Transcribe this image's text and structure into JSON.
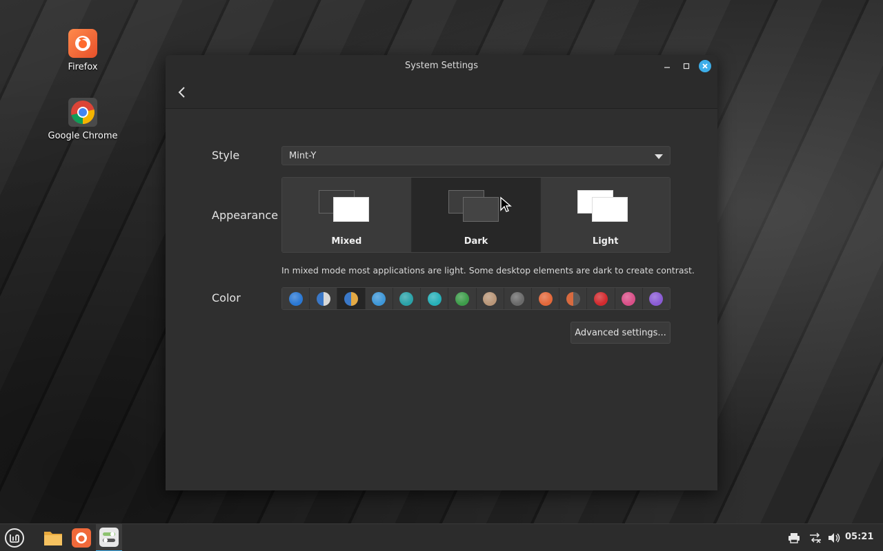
{
  "desktop": {
    "icons": [
      {
        "label": "Firefox",
        "icon": "firefox-icon"
      },
      {
        "label": "Google Chrome",
        "icon": "chrome-icon"
      }
    ]
  },
  "window": {
    "title": "System Settings",
    "controls": {
      "minimize": "minimize",
      "maximize": "maximize",
      "close": "close"
    }
  },
  "settings": {
    "style": {
      "label": "Style",
      "value": "Mint-Y"
    },
    "appearance": {
      "label": "Appearance",
      "options": [
        {
          "label": "Mixed",
          "selected": false
        },
        {
          "label": "Dark",
          "selected": true
        },
        {
          "label": "Light",
          "selected": false
        }
      ],
      "hint": "In mixed mode most applications are light. Some desktop elements are dark to create contrast."
    },
    "color": {
      "label": "Color",
      "swatches": [
        "#2a78d4",
        "#3a78c8",
        "#e3a945",
        "#3e97d8",
        "#2aa2a8",
        "#26b0b8",
        "#3d9c4a",
        "#b99678",
        "#6a6a6a",
        "#e4683a",
        "#d86a3f",
        "#d22a2e",
        "#d94f88",
        "#8a5bd4"
      ],
      "selected_index": 2
    },
    "advanced_button": "Advanced settings..."
  },
  "taskbar": {
    "clock": "05:21",
    "apps": [
      "menu-icon",
      "files-icon",
      "firefox-icon",
      "settings-icon"
    ],
    "active_index": 3
  },
  "colors": {
    "accent": "#3daee9"
  }
}
